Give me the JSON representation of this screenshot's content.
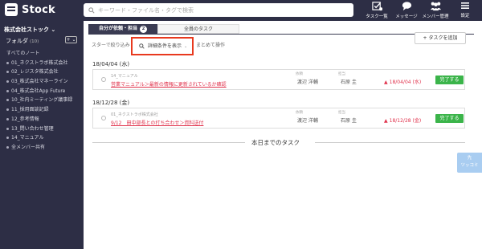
{
  "app": {
    "name": "Stock"
  },
  "search": {
    "placeholder": "キーワード・ファイル名・タグで検索"
  },
  "nav": {
    "items": [
      {
        "label": "タスク一覧",
        "icon": "task-list-icon"
      },
      {
        "label": "メッセージ",
        "icon": "message-icon"
      },
      {
        "label": "メンバー管理",
        "icon": "members-icon"
      },
      {
        "label": "設定",
        "icon": "menu-icon"
      }
    ]
  },
  "sidebar": {
    "company": "株式会社ストック ⌄",
    "folder_title": "フォルダ",
    "folder_count": "(10)",
    "add_folder": "+ ⌄",
    "items": [
      "すべてのノート",
      "01_ネクストラボ株式会社",
      "02_レジスタ株式会社",
      "03_株式会社マネーライン",
      "04_株式会社App Future",
      "10_社内ミーティング議事録",
      "11_採用面談記録",
      "12_参考情報",
      "13_問い合わせ管理",
      "14_マニュアル",
      "全メンバー共有"
    ]
  },
  "tabs": {
    "active": "自分が依頼・担当",
    "active_badge": "2",
    "inactive": "全員のタスク"
  },
  "filters": {
    "star": "スターで絞り込み",
    "detail": "詳細条件を表示",
    "detail_chevron": "⌄",
    "bulk": "まとめて操作"
  },
  "add_task": "+ タスクを追加",
  "groups": [
    {
      "date": "18/04/04 (水)",
      "task": {
        "folder": "14_マニュアル",
        "title": "営業マニュアル＞最新の情報に更新されているか確認",
        "requester_label": "依頼",
        "requester": "渡辺 洋輔",
        "assignee_label": "担当",
        "assignee": "石原 圭",
        "due": "18/04/04 (水)",
        "done": "完了する"
      }
    },
    {
      "date": "18/12/28 (金)",
      "task": {
        "folder": "01_ネクストラボ株式会社",
        "title": "9/12　田中部長との打ち合わせ＞資料送付",
        "requester_label": "依頼",
        "requester": "渡辺 洋輔",
        "assignee_label": "担当",
        "assignee": "石原 圭",
        "due": "18/12/28 (金)",
        "done": "完了する"
      }
    }
  ],
  "today_label": "本日までのタスク",
  "side_tab": "先\nツッコミ",
  "colors": {
    "brand": "#2d2e45",
    "accent_red": "#e0314b",
    "highlight": "#e8391e",
    "success": "#3bb44a"
  }
}
